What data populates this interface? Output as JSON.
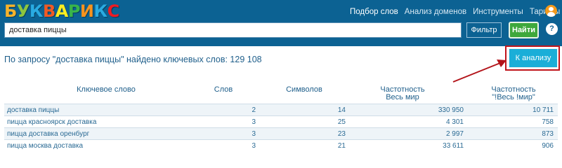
{
  "header": {
    "logo_letters": [
      {
        "ch": "Б",
        "color": "#f7b32b"
      },
      {
        "ch": "У",
        "color": "#8cc63f"
      },
      {
        "ch": "К",
        "color": "#29abe2"
      },
      {
        "ch": "В",
        "color": "#f15a24"
      },
      {
        "ch": "А",
        "color": "#fcee21"
      },
      {
        "ch": "Р",
        "color": "#39b54a"
      },
      {
        "ch": "И",
        "color": "#f7931e"
      },
      {
        "ch": "К",
        "color": "#29abe2"
      },
      {
        "ch": "С",
        "color": "#ed1c24"
      }
    ],
    "nav": [
      "Подбор слов",
      "Анализ доменов",
      "Инструменты",
      "Тарифы"
    ],
    "search_value": "доставка пиццы",
    "filter_label": "Фильтр",
    "find_label": "Найти",
    "help_label": "?"
  },
  "summary": "По запросу \"доставка пиццы\" найдено ключевых слов: 129 108",
  "analysis_button": "К анализу",
  "table": {
    "headers": {
      "keyword": "Ключевое слово",
      "words": "Слов",
      "symbols": "Символов",
      "freq_all": [
        "Частотность",
        "Весь мир"
      ],
      "freq_exact": [
        "Частотность",
        "\"!Весь !мир\""
      ]
    },
    "rows": [
      {
        "keyword": "доставка пиццы",
        "words": "2",
        "symbols": "14",
        "freq_all": "330 950",
        "freq_exact": "10 711"
      },
      {
        "keyword": "пицца красноярск доставка",
        "words": "3",
        "symbols": "25",
        "freq_all": "4 301",
        "freq_exact": "758"
      },
      {
        "keyword": "пицца доставка оренбург",
        "words": "3",
        "symbols": "23",
        "freq_all": "2 997",
        "freq_exact": "873"
      },
      {
        "keyword": "пицца москва доставка",
        "words": "3",
        "symbols": "21",
        "freq_all": "33 611",
        "freq_exact": "906"
      }
    ]
  },
  "colors": {
    "header_bg": "#0c6293",
    "find_button": "#3ea83c",
    "analysis_button": "#1aaed8",
    "highlight": "#c0141b"
  }
}
